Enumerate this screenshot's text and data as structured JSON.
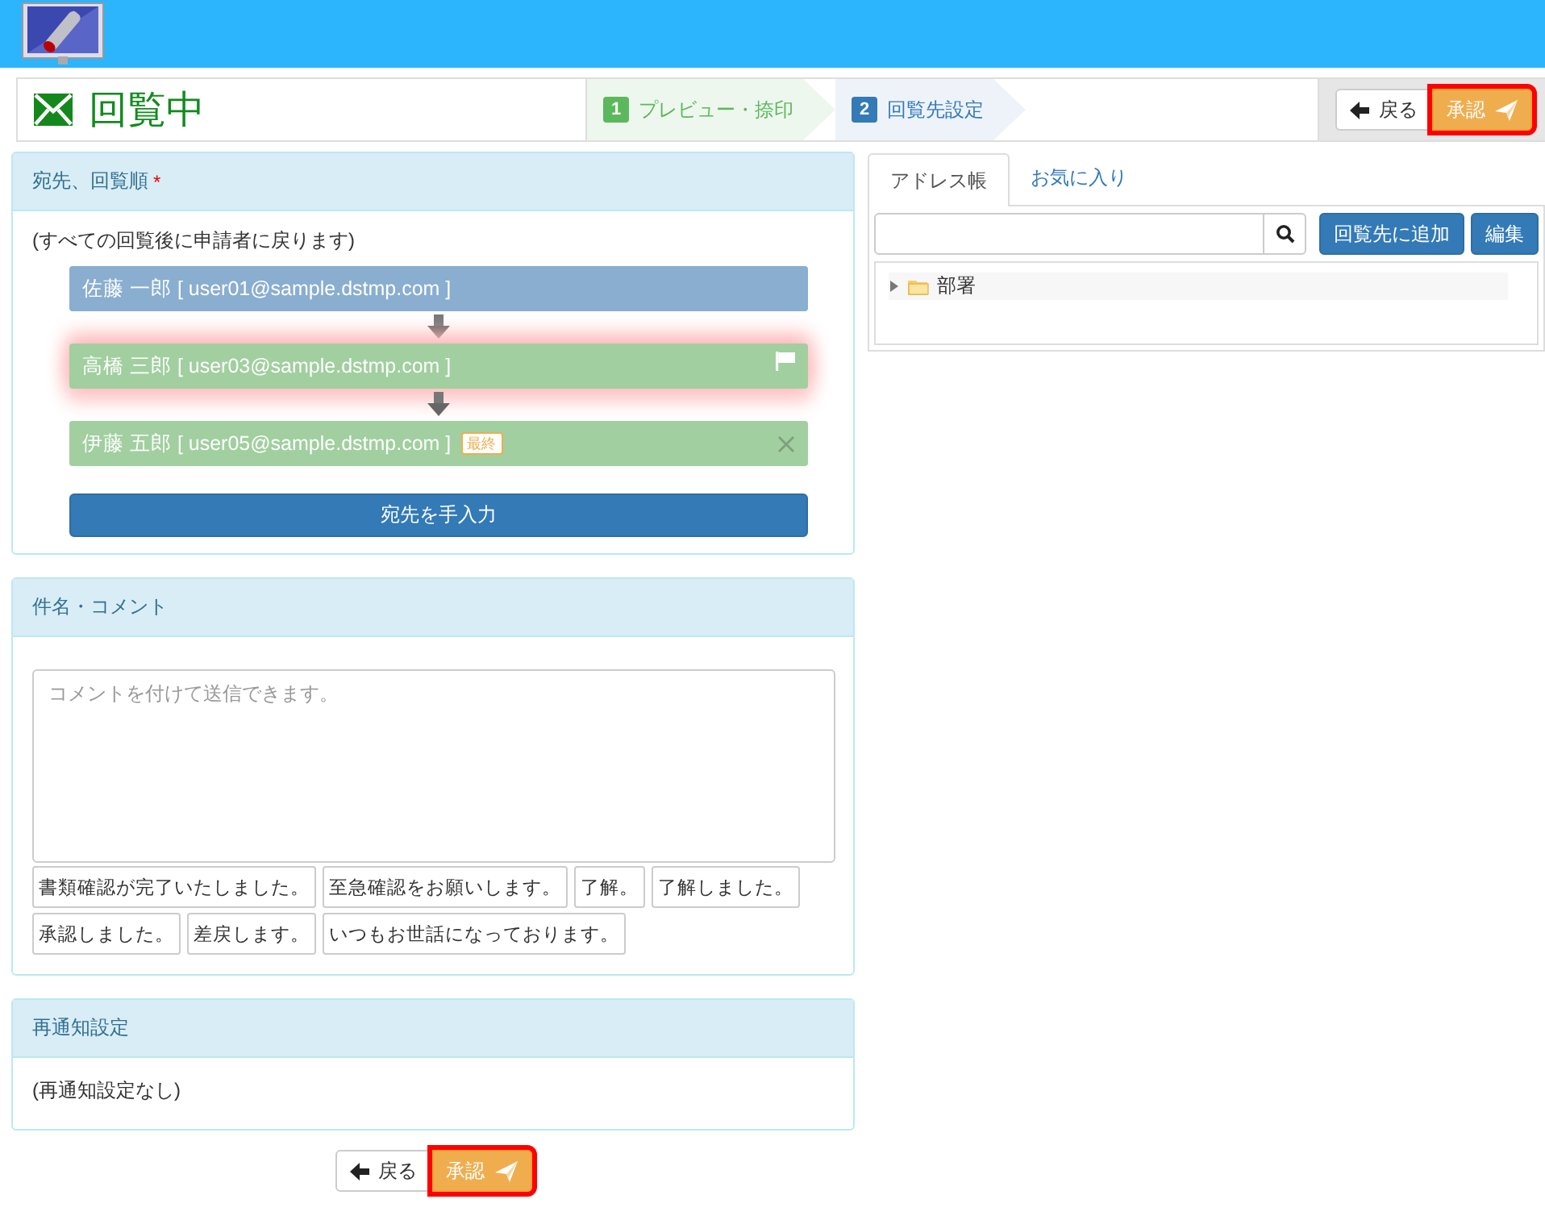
{
  "title": {
    "text": "回覧中"
  },
  "steps": [
    {
      "number": "1",
      "label": "プレビュー・捺印",
      "current": false
    },
    {
      "number": "2",
      "label": "回覧先設定",
      "current": true
    }
  ],
  "top_actions": [
    {
      "kind": "back",
      "label": "戻る",
      "highlighted": false
    },
    {
      "kind": "approve",
      "label": "承認",
      "highlighted": true
    }
  ],
  "recipients_panel": {
    "title": "宛先、回覧順",
    "required_mark": "*",
    "note": "(すべての回覧後に申請者に戻ります)",
    "recipients": [
      {
        "text": "佐藤 一郎 [ user01@sample.dstmp.com ]",
        "color": "#89aecf",
        "current": false,
        "flag": false,
        "removable": false
      },
      {
        "text": "高橋 三郎 [ user03@sample.dstmp.com ]",
        "color": "#a1cf9f",
        "current": true,
        "flag": true,
        "removable": false
      },
      {
        "text": "伊藤 五郎 [ user05@sample.dstmp.com ]",
        "color": "#a1cf9f",
        "current": false,
        "flag": false,
        "removable": true,
        "badge": "最終"
      }
    ],
    "manual_button": "宛先を手入力"
  },
  "comment_panel": {
    "title": "件名・コメント",
    "placeholder": "コメントを付けて送信できます。",
    "phrases": [
      "書類確認が完了いたしました。",
      "至急確認をお願いします。",
      "了解。",
      "了解しました。",
      "承認しました。",
      "差戻します。",
      "いつもお世話になっております。"
    ]
  },
  "renotify_panel": {
    "title": "再通知設定",
    "text": "(再通知設定なし)"
  },
  "bottom_actions": [
    {
      "kind": "back",
      "label": "戻る",
      "highlighted": false
    },
    {
      "kind": "approve",
      "label": "承認",
      "highlighted": true
    }
  ],
  "address_tabs": [
    {
      "label": "アドレス帳",
      "selected": true
    },
    {
      "label": "お気に入り",
      "selected": false
    }
  ],
  "address_book": {
    "add_button": "回覧先に追加",
    "edit_button": "編集",
    "tree": [
      {
        "label": "部署",
        "expanded": false
      }
    ]
  }
}
